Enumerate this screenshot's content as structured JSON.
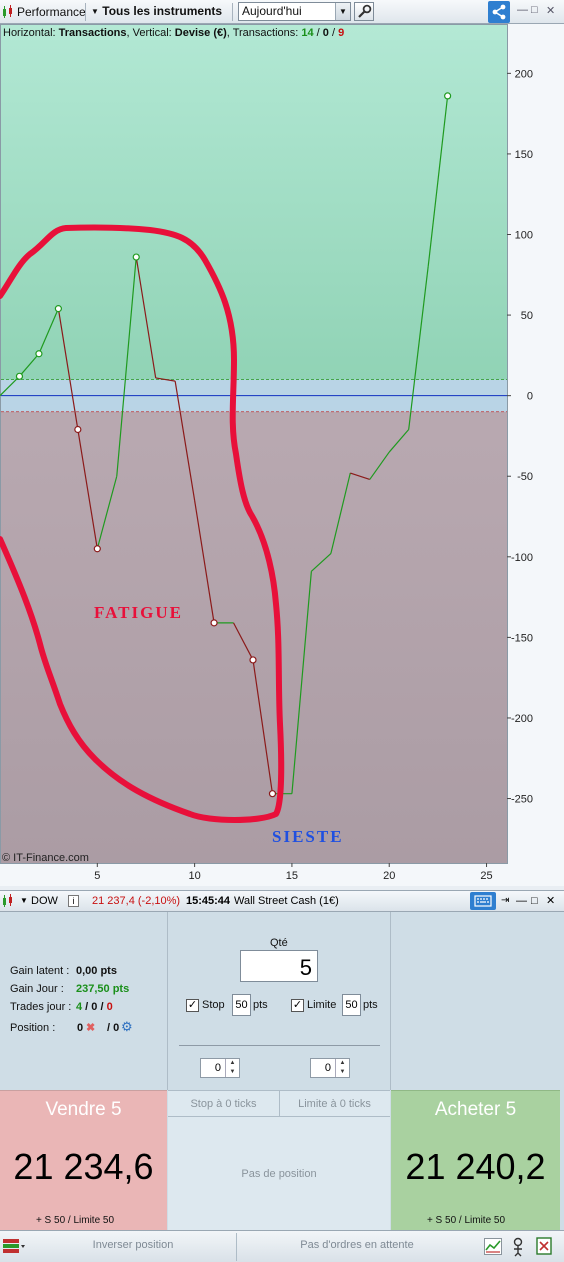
{
  "toolbar": {
    "performance_label": "Performance",
    "instruments_label": "Tous les instruments",
    "period_value": "Aujourd'hui",
    "close_glyph": "✕",
    "min_glyph": "—",
    "restore_glyph": "□"
  },
  "chart_info": {
    "horizontal_prefix": "Horizontal: ",
    "horizontal_value": "Transactions",
    "vertical_prefix": ", Vertical: ",
    "vertical_value": "Devise (€)",
    "transactions_prefix": ", Transactions: ",
    "trans_win": "14",
    "trans_sep1": " / ",
    "trans_zero": "0",
    "trans_sep2": " / ",
    "trans_loss": "9"
  },
  "chart_annotations": {
    "fatigue": "FATIGUE",
    "sieste": "SIESTE",
    "copyright": "© IT-Finance.com"
  },
  "chart_data": {
    "type": "line",
    "xlim": [
      0,
      26
    ],
    "ylim": [
      -290,
      230
    ],
    "x_ticks": [
      5,
      10,
      15,
      20,
      25
    ],
    "y_ticks": [
      200,
      150,
      100,
      50,
      0,
      -50,
      -100,
      -150,
      -200,
      -250
    ],
    "zero_band": [
      -10,
      10
    ],
    "points": [
      {
        "x": 0,
        "y": 0
      },
      {
        "x": 1,
        "y": 12
      },
      {
        "x": 2,
        "y": 26
      },
      {
        "x": 3,
        "y": 54
      },
      {
        "x": 4,
        "y": -21
      },
      {
        "x": 5,
        "y": -95
      },
      {
        "x": 6,
        "y": -50
      },
      {
        "x": 7,
        "y": 86
      },
      {
        "x": 8,
        "y": 11
      },
      {
        "x": 9,
        "y": 9
      },
      {
        "x": 10,
        "y": -65
      },
      {
        "x": 11,
        "y": -141
      },
      {
        "x": 12,
        "y": -141
      },
      {
        "x": 13,
        "y": -164
      },
      {
        "x": 14,
        "y": -247
      },
      {
        "x": 15,
        "y": -247
      },
      {
        "x": 16,
        "y": -109
      },
      {
        "x": 17,
        "y": -98
      },
      {
        "x": 18,
        "y": -48
      },
      {
        "x": 19,
        "y": -52
      },
      {
        "x": 20,
        "y": -35
      },
      {
        "x": 21,
        "y": -21
      },
      {
        "x": 22,
        "y": 80
      },
      {
        "x": 23,
        "y": 186
      }
    ],
    "markers": [
      1,
      2,
      3,
      4,
      5,
      7,
      11,
      13,
      14,
      23
    ],
    "colors": {
      "up": "#1f9a1f",
      "down": "#8b1a1a",
      "pos_bg": "#a6e2cc",
      "neg_bg": "#b4a6ae",
      "band": "#b9d4e6",
      "zero_line": "#1030c0",
      "scribble": "#e8103a"
    }
  },
  "instrument_bar": {
    "name": "DOW",
    "price": "21 237,4 (-2,10%)",
    "time": "15:45:44",
    "description": "Wall Street Cash (1€)"
  },
  "order_panel": {
    "gain_latent_label": "Gain latent :",
    "gain_latent_value": "0,00 pts",
    "gain_jour_label": "Gain Jour :",
    "gain_jour_value": "237,50 pts",
    "trades_label": "Trades jour :",
    "trades_win": "4",
    "trades_sep1": " / ",
    "trades_zero": "0",
    "trades_sep2": " / ",
    "trades_loss": "0",
    "position_label": "Position :",
    "position_a": "0",
    "position_b": "/ 0",
    "qty_label": "Qté",
    "qty_value": "5",
    "stop_label": "Stop",
    "stop_value": "50",
    "stop_unit": "pts",
    "limit_label": "Limite",
    "limit_value": "50",
    "limit_unit": "pts",
    "spin_left": "0",
    "spin_right": "0",
    "stop_ticks": "Stop à 0 ticks",
    "limit_ticks": "Limite à 0 ticks",
    "no_position": "Pas de position",
    "sell_label": "Vendre 5",
    "sell_price": "21 234,6",
    "sell_sub": "+ S 50 / Limite 50",
    "buy_label": "Acheter 5",
    "buy_price": "21 240,2",
    "buy_sub": "+ S 50 / Limite 50"
  },
  "bottom_bar": {
    "reverse_label": "Inverser position",
    "pending_label": "Pas d'ordres en attente"
  }
}
